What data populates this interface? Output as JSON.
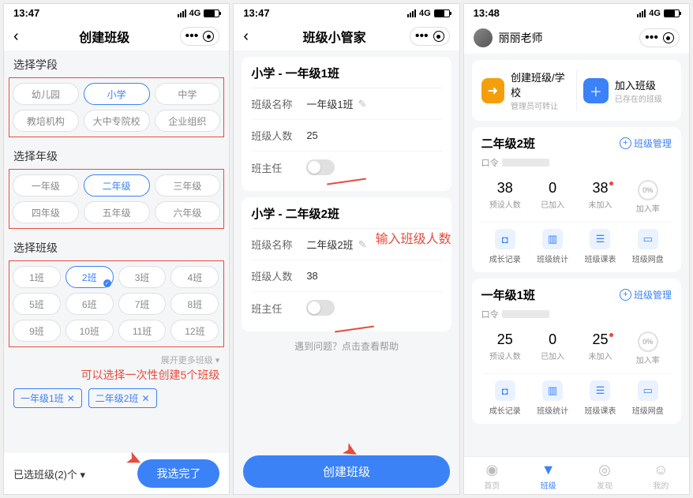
{
  "status": {
    "time1": "13:47",
    "time2": "13:47",
    "time3": "13:48",
    "network": "4G"
  },
  "p1": {
    "title": "创建班级",
    "sec_stage": "选择学段",
    "stages": [
      "幼儿园",
      "小学",
      "中学",
      "教培机构",
      "大中专院校",
      "企业组织"
    ],
    "sec_grade": "选择年级",
    "grades": [
      "一年级",
      "二年级",
      "三年级",
      "四年级",
      "五年级",
      "六年级"
    ],
    "sec_class": "选择班级",
    "classes": [
      "1班",
      "2班",
      "3班",
      "4班",
      "5班",
      "6班",
      "7班",
      "8班",
      "9班",
      "10班",
      "11班",
      "12班"
    ],
    "expand": "展开更多班级",
    "note": "可以选择一次性创建5个班级",
    "tag1": "一年级1班",
    "tag2": "二年级2班",
    "selected_label": "已选班级(2)个",
    "done_btn": "我选完了"
  },
  "p2": {
    "title": "班级小管家",
    "c1_title": "小学 - 一年级1班",
    "c2_title": "小学 - 二年级2班",
    "label_name": "班级名称",
    "label_count": "班级人数",
    "label_teacher": "班主任",
    "c1_name": "一年级1班",
    "c1_count": "25",
    "c2_name": "二年级2班",
    "c2_count": "38",
    "help": "遇到问题？点击查看帮助",
    "create_btn": "创建班级",
    "note": "输入班级人数"
  },
  "p3": {
    "teacher": "丽丽老师",
    "create_label": "创建班级/学校",
    "create_sub": "管理员可转让",
    "join_label": "加入班级",
    "join_sub": "已存在的班级",
    "manage": "班级管理",
    "code_label": "口令",
    "stat1": "预设人数",
    "stat2": "已加入",
    "stat3": "未加入",
    "stat4": "加入率",
    "icon1": "成长记录",
    "icon2": "班级统计",
    "icon3": "班级课表",
    "icon4": "班级网盘",
    "class1": {
      "name": "二年级2班",
      "s1": "38",
      "s2": "0",
      "s3": "38",
      "s4": "0%"
    },
    "class2": {
      "name": "一年级1班",
      "s1": "25",
      "s2": "0",
      "s3": "25",
      "s4": "0%"
    },
    "tab1": "首页",
    "tab2": "班级",
    "tab3": "发现",
    "tab4": "我的"
  }
}
